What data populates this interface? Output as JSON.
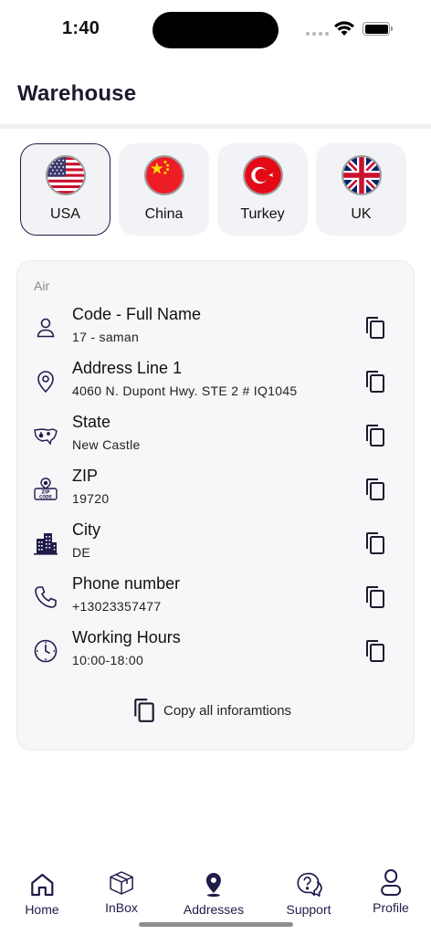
{
  "status_bar": {
    "time": "1:40"
  },
  "header": {
    "title": "Warehouse"
  },
  "countries": [
    {
      "label": "USA",
      "flag": "usa-flag-icon",
      "active": true
    },
    {
      "label": "China",
      "flag": "china-flag-icon",
      "active": false
    },
    {
      "label": "Turkey",
      "flag": "turkey-flag-icon",
      "active": false
    },
    {
      "label": "UK",
      "flag": "uk-flag-icon",
      "active": false
    }
  ],
  "address": {
    "shipping_type": "Air",
    "rows": [
      {
        "title": "Code - Full Name",
        "value": "17 - saman",
        "icon": "user-icon"
      },
      {
        "title": "Address Line 1",
        "value": "4060 N. Dupont Hwy. STE 2 # IQ1045",
        "icon": "location-pin-icon"
      },
      {
        "title": "State",
        "value": "New Castle",
        "icon": "usa-map-icon"
      },
      {
        "title": "ZIP",
        "value": "19720",
        "icon": "zip-code-icon"
      },
      {
        "title": "City",
        "value": "DE",
        "icon": "city-buildings-icon"
      },
      {
        "title": "Phone number",
        "value": "+13023357477",
        "icon": "phone-icon"
      },
      {
        "title": "Working Hours",
        "value": "10:00-18:00",
        "icon": "clock-icon"
      }
    ],
    "copy_all_label": "Copy all inforamtions"
  },
  "nav": [
    {
      "label": "Home",
      "icon": "home-icon"
    },
    {
      "label": "InBox",
      "icon": "box-icon"
    },
    {
      "label": "Addresses",
      "icon": "location-pin-icon"
    },
    {
      "label": "Support",
      "icon": "support-chat-icon"
    },
    {
      "label": "Profile",
      "icon": "profile-icon"
    }
  ],
  "colors": {
    "primary": "#1f1b4a",
    "tab_background": "#f2f3f6",
    "card_background": "#f7f7f9"
  }
}
